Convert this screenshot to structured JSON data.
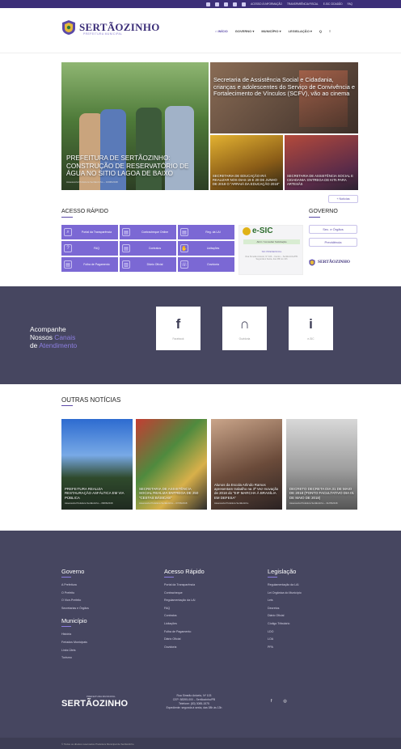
{
  "topbar": {
    "links": [
      "ACESSO À INFORMAÇÃO",
      "TRANSPARÊNCIA FISCAL",
      "E-SIC CIDADÃO",
      "FAQ"
    ]
  },
  "header": {
    "brand": "SERTÃOZINHO",
    "brand_sub": "PREFEITURA MUNICIPAL",
    "nav": [
      "INÍCIO",
      "GOVERNO ▾",
      "MUNICÍPIO ▾",
      "LEGISLAÇÃO ▾",
      "Q",
      "≡"
    ]
  },
  "hero": {
    "main_title": "PREFEITURA DE SERTÃOZINHO: CONSTRUÇÃO DE RESERVATÓRIO DE ÁGUA NO SITIO LAGOA DE BAIXO",
    "main_meta": "Assessoria Prefeitura Sertãozinho – 13/06/2018",
    "r1_title": "Secretaria de Assistência Social e Cidadania, crianças e adolescentes do Serviço de Convivência e Fortalecimento de Vínculos (SCFV), vão ao cinema",
    "r2_title": "SECRETARIA DE EDUCAÇÃO IRÁ REALIZAR NOS DIAS 19 E 20 DE JUNHO DE 2018 O “ARRAIÁ DA EDUCAÇÃO 2018”",
    "r3_title": "SECRETARIA DE ASSISTÊNCIA SOCIAL E CIDADANIA: ENTREGA DE KITs PARA ARTESÃS",
    "more": "+ Notícias"
  },
  "quick": {
    "title": "ACESSO RÁPIDO",
    "items": [
      "Portal da Transparência",
      "Contracheque Online",
      "Reg. da LAI",
      "FAQ",
      "Contratos",
      "Licitações",
      "Folha de Pagamento",
      "Diário Oficial",
      "Ouvidoria"
    ],
    "icons": [
      "magnifier-icon",
      "doc-icon",
      "doc-icon",
      "faq-icon",
      "doc-icon",
      "hand-icon",
      "doc-icon",
      "book-icon",
      "chat-icon"
    ]
  },
  "esic": {
    "logo": "e-SIC",
    "sub": "Abrir / Consultar Solicitação",
    "heading": "SIC PRESENCIAL",
    "text": "Rua Simeão Aniceto, Nº 103 – Centro – Sertãozinho/PB. Segunda à Sexta, das 08h às 13h"
  },
  "governo": {
    "title": "GOVERNO",
    "buttons": [
      "Sec. e Órgãos",
      "Previdência"
    ],
    "brand": "SERTÃOZINHO"
  },
  "channels": {
    "line1": "Acompanhe",
    "line2a": "Nossos ",
    "line2b": "Canais",
    "line3a": "de ",
    "line3b": "Atendimento",
    "items": [
      {
        "icon": "f",
        "label": "Facebook"
      },
      {
        "icon": "∩",
        "label": "Ouvidoria"
      },
      {
        "icon": "i",
        "label": "e-SIC"
      }
    ]
  },
  "other": {
    "title": "OUTRAS NOTÍCIAS",
    "cards": [
      {
        "title": "PREFEITURA REALIZA RESTAURAÇÃO ASFÁLTICA EM VIA PÚBLICA",
        "meta": "Assessoria Prefeitura Sertãozinho – 08/06/2018"
      },
      {
        "title": "SECRETARIA DE ASSISTÊNCIA SOCIAL REALIZA ENTREGA DE 250 “CESTAS BÁSICAS”",
        "meta": "Assessoria Prefeitura Sertãozinho – 07/06/2018"
      },
      {
        "title": "Alunos da Escola Arlindo Ramos apresentam trabalho na 3ª Vez Inovação de 2018 do “EIF MARCHA À BRASÍLIA EM DEFESA”",
        "meta": "Assessoria Prefeitura Sertãozinho"
      },
      {
        "title": "DECRETO DECRETA DIA 31 DE MAIO DE 2018 (PONTO FACULTATIVO DIA 01 DE MAIO DE 2018)",
        "meta": "Assessoria Prefeitura Sertãozinho – 31/05/2018"
      }
    ]
  },
  "footer": {
    "governo_title": "Governo",
    "governo_links": [
      "A Prefeitura",
      "O Prefeito",
      "O Vice-Prefeito",
      "Secretarias e Órgãos"
    ],
    "municipio_title": "Município",
    "municipio_links": [
      "História",
      "Feriados Municipais",
      "Links Úteis",
      "Turismo"
    ],
    "acesso_title": "Acesso Rápido",
    "acesso_links": [
      "Portal da Transparência",
      "Contracheque",
      "Regulamentação da LAI",
      "FAQ",
      "Contratos",
      "Licitações",
      "Folha de Pagamento",
      "Diário Oficial",
      "Ouvidoria"
    ],
    "leg_title": "Legislação",
    "leg_links": [
      "Regulamentação da LAI",
      "Lei Orgânica do Município",
      "Leis",
      "Decretos",
      "Diário Oficial",
      "Código Tributário",
      "LDO",
      "LOA",
      "PPA"
    ],
    "brand": "SERTÃOZINHO",
    "brand_sub": "PREFEITURA MUNICIPAL",
    "address": [
      "Rua Simeão Aniceto, Nº 103",
      "CEP: 58395-000 – Sertãozinho/PB",
      "Telefone: (83) 3085-1575",
      "Expediente: segunda à sexta, das 08h às 13h"
    ],
    "social": [
      "f",
      "◎"
    ],
    "copyright": "© Todos os direitos reservados Prefeitura Municipal de Sertãozinho"
  },
  "colors": {
    "purple": "#3c2f78",
    "accent": "#7b68d4",
    "dark": "#464660"
  }
}
